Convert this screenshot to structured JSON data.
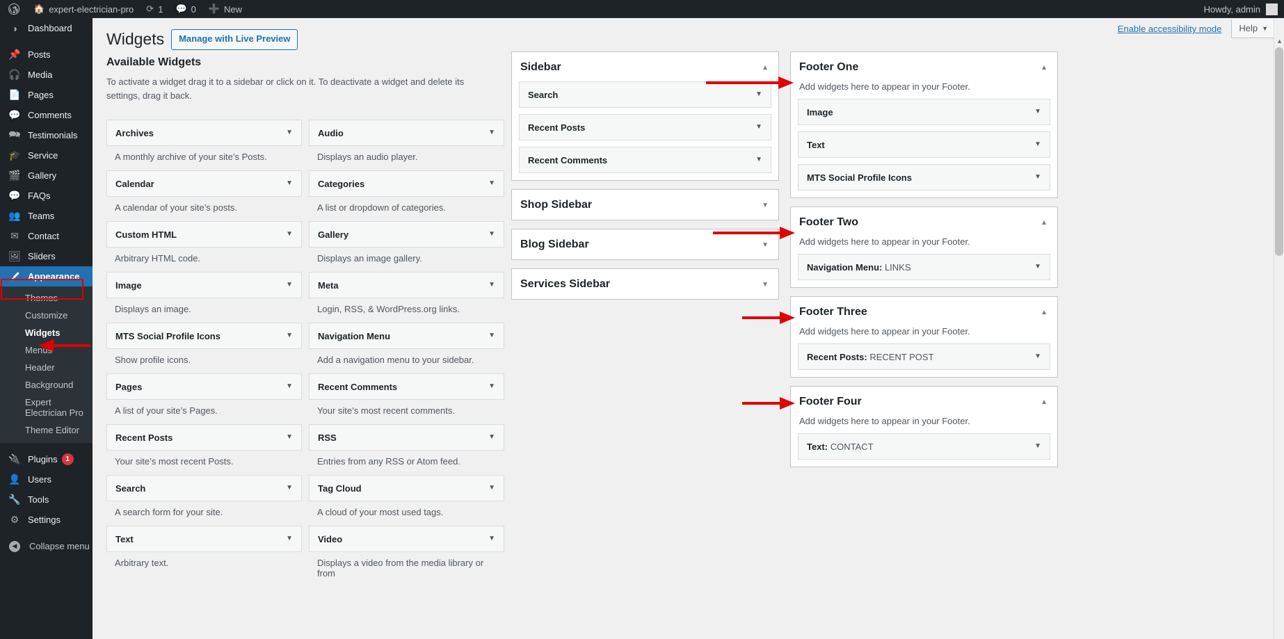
{
  "adminbar": {
    "logo_icon": "wordpress-logo-icon",
    "site_icon": "home-icon",
    "site_name": "expert-electrician-pro",
    "updates_icon": "updates-icon",
    "updates_count": "1",
    "comments_icon": "comment-icon",
    "comments_count": "0",
    "new_icon": "plus-icon",
    "new_label": "New",
    "howdy": "Howdy, admin"
  },
  "adminmenu": {
    "items": [
      {
        "label": "Dashboard",
        "icon": "dashboard-icon",
        "separator": false
      },
      {
        "label": "Posts",
        "icon": "pin-icon",
        "separator": true
      },
      {
        "label": "Media",
        "icon": "media-icon",
        "separator": false
      },
      {
        "label": "Pages",
        "icon": "pages-icon",
        "separator": false
      },
      {
        "label": "Comments",
        "icon": "comment-icon",
        "separator": false
      },
      {
        "label": "Testimonials",
        "icon": "testimonials-icon",
        "separator": false
      },
      {
        "label": "Service",
        "icon": "service-icon",
        "separator": false
      },
      {
        "label": "Gallery",
        "icon": "gallery-icon",
        "separator": false
      },
      {
        "label": "FAQs",
        "icon": "faqs-icon",
        "separator": false
      },
      {
        "label": "Teams",
        "icon": "teams-icon",
        "separator": false
      },
      {
        "label": "Contact",
        "icon": "mail-icon",
        "separator": false
      },
      {
        "label": "Sliders",
        "icon": "sliders-icon",
        "separator": false
      }
    ],
    "appearance": {
      "label": "Appearance",
      "icon": "appearance-brush-icon"
    },
    "appearance_submenu": [
      {
        "label": "Themes",
        "current": false
      },
      {
        "label": "Customize",
        "current": false
      },
      {
        "label": "Widgets",
        "current": true
      },
      {
        "label": "Menus",
        "current": false
      },
      {
        "label": "Header",
        "current": false
      },
      {
        "label": "Background",
        "current": false
      },
      {
        "label": "Expert Electrician Pro",
        "current": false
      },
      {
        "label": "Theme Editor",
        "current": false
      }
    ],
    "bottom_items": [
      {
        "label": "Plugins",
        "icon": "plugins-icon",
        "count": "1"
      },
      {
        "label": "Users",
        "icon": "users-icon",
        "count": ""
      },
      {
        "label": "Tools",
        "icon": "tools-wrench-icon",
        "count": ""
      },
      {
        "label": "Settings",
        "icon": "settings-sliders-icon",
        "count": ""
      }
    ],
    "collapse": {
      "label": "Collapse menu",
      "icon": "collapse-arrow-icon"
    }
  },
  "screen_meta": {
    "accessibility_link": "Enable accessibility mode",
    "help_label": "Help",
    "help_caret_icon": "chevron-down-icon"
  },
  "header": {
    "title": "Widgets",
    "live_preview_button": "Manage with Live Preview"
  },
  "available": {
    "heading": "Available Widgets",
    "description": "To activate a widget drag it to a sidebar or click on it. To deactivate a widget and delete its settings, drag it back.",
    "widgets": [
      {
        "name": "Archives",
        "desc": "A monthly archive of your site’s Posts."
      },
      {
        "name": "Audio",
        "desc": "Displays an audio player."
      },
      {
        "name": "Calendar",
        "desc": "A calendar of your site’s posts."
      },
      {
        "name": "Categories",
        "desc": "A list or dropdown of categories."
      },
      {
        "name": "Custom HTML",
        "desc": "Arbitrary HTML code."
      },
      {
        "name": "Gallery",
        "desc": "Displays an image gallery."
      },
      {
        "name": "Image",
        "desc": "Displays an image."
      },
      {
        "name": "Meta",
        "desc": "Login, RSS, & WordPress.org links."
      },
      {
        "name": "MTS Social Profile Icons",
        "desc": "Show profile icons."
      },
      {
        "name": "Navigation Menu",
        "desc": "Add a navigation menu to your sidebar."
      },
      {
        "name": "Pages",
        "desc": "A list of your site’s Pages."
      },
      {
        "name": "Recent Comments",
        "desc": "Your site’s most recent comments."
      },
      {
        "name": "Recent Posts",
        "desc": "Your site’s most recent Posts."
      },
      {
        "name": "RSS",
        "desc": "Entries from any RSS or Atom feed."
      },
      {
        "name": "Search",
        "desc": "A search form for your site."
      },
      {
        "name": "Tag Cloud",
        "desc": "A cloud of your most used tags."
      },
      {
        "name": "Text",
        "desc": "Arbitrary text."
      },
      {
        "name": "Video",
        "desc": "Displays a video from the media library or from"
      }
    ]
  },
  "sidebars_mid": [
    {
      "title": "Sidebar",
      "open": true,
      "desc": "",
      "widgets": [
        {
          "name": "Search",
          "value": ""
        },
        {
          "name": "Recent Posts",
          "value": ""
        },
        {
          "name": "Recent Comments",
          "value": ""
        }
      ]
    },
    {
      "title": "Shop Sidebar",
      "open": false,
      "desc": "",
      "widgets": []
    },
    {
      "title": "Blog Sidebar",
      "open": false,
      "desc": "",
      "widgets": []
    },
    {
      "title": "Services Sidebar",
      "open": false,
      "desc": "",
      "widgets": []
    }
  ],
  "sidebars_right": [
    {
      "title": "Footer One",
      "open": true,
      "desc": "Add widgets here to appear in your Footer.",
      "widgets": [
        {
          "name": "Image",
          "value": ""
        },
        {
          "name": "Text",
          "value": ""
        },
        {
          "name": "MTS Social Profile Icons",
          "value": ""
        }
      ]
    },
    {
      "title": "Footer Two",
      "open": true,
      "desc": "Add widgets here to appear in your Footer.",
      "widgets": [
        {
          "name": "Navigation Menu:",
          "value": "LINKS"
        }
      ]
    },
    {
      "title": "Footer Three",
      "open": true,
      "desc": "Add widgets here to appear in your Footer.",
      "widgets": [
        {
          "name": "Recent Posts:",
          "value": "RECENT POST"
        }
      ]
    },
    {
      "title": "Footer Four",
      "open": true,
      "desc": "Add widgets here to appear in your Footer.",
      "widgets": [
        {
          "name": "Text:",
          "value": "CONTACT"
        }
      ]
    }
  ],
  "annotations": {
    "color": "#e00000",
    "arrow_targets": [
      "Widgets",
      "Footer One",
      "Footer Two",
      "Footer Three",
      "Footer Four"
    ]
  }
}
